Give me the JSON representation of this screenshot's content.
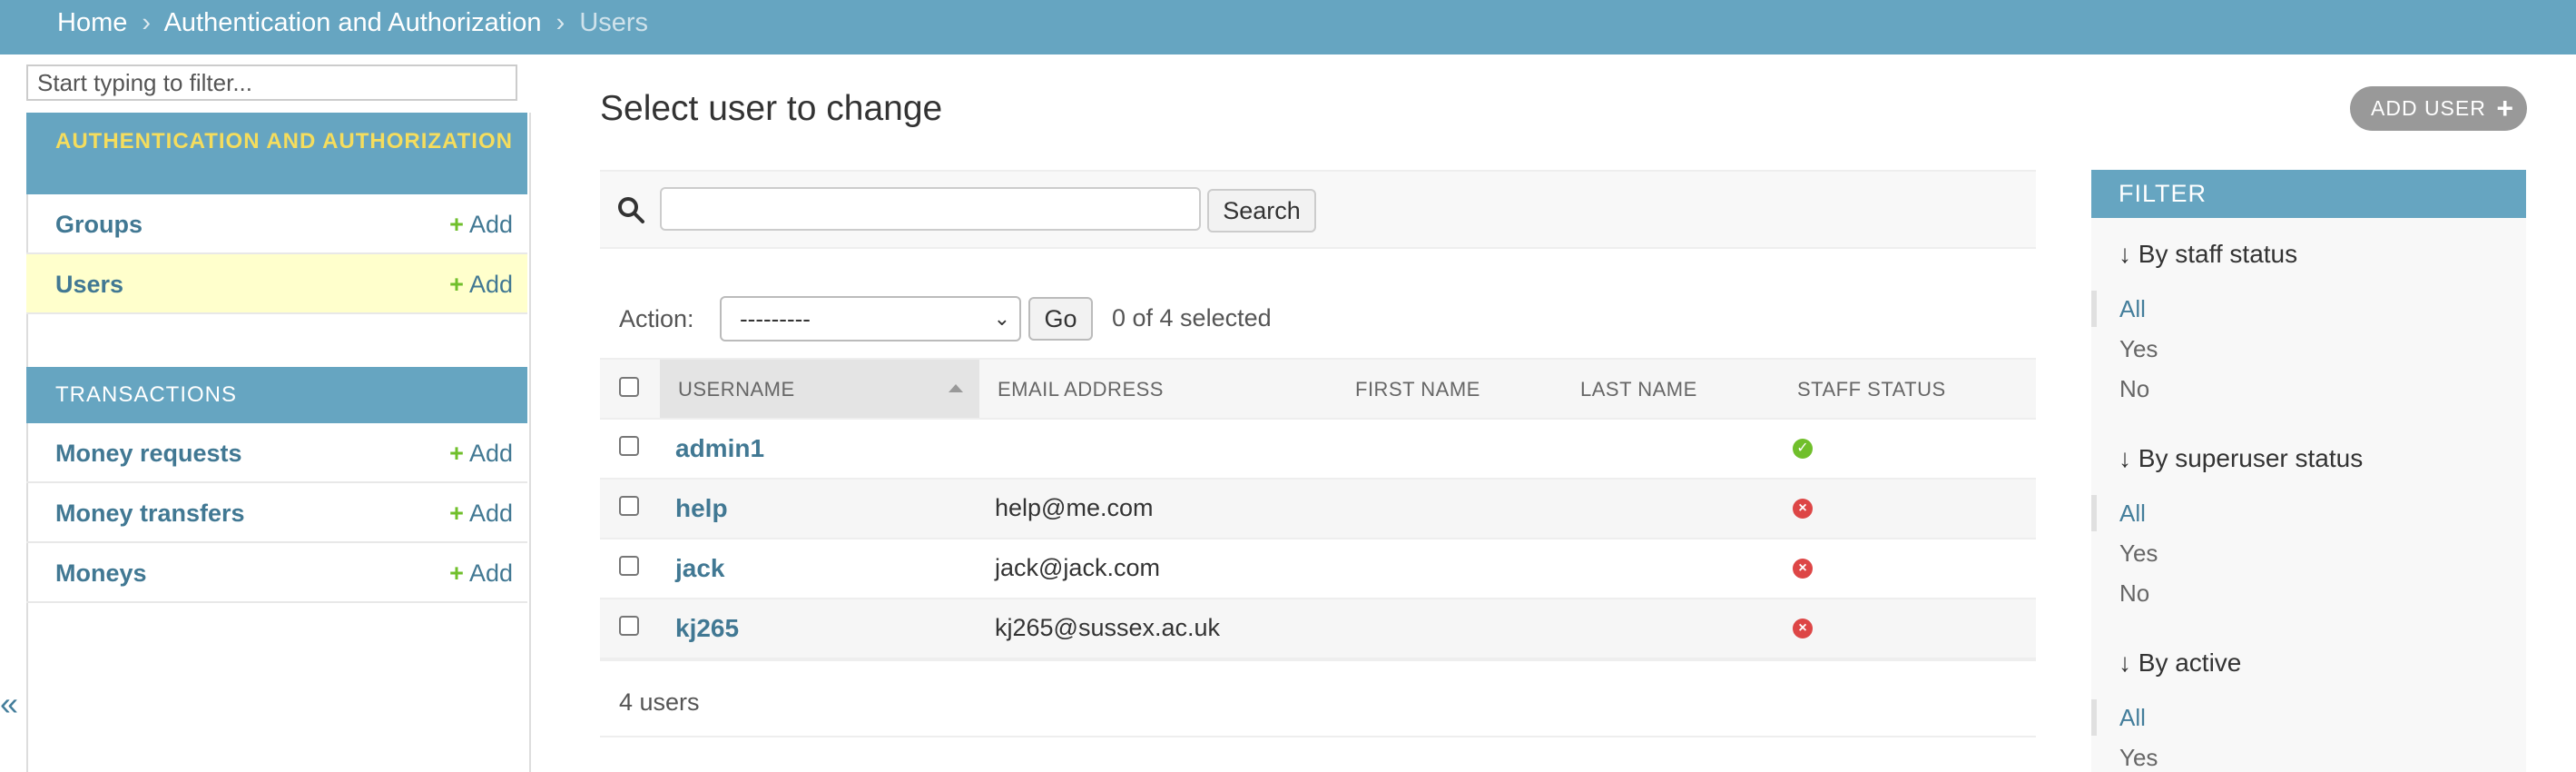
{
  "breadcrumbs": {
    "home": "Home",
    "sep": "›",
    "section": "Authentication and Authorization",
    "current": "Users"
  },
  "sidebar": {
    "filter_placeholder": "Start typing to filter...",
    "apps": [
      {
        "caption": "AUTHENTICATION AND AUTHORIZATION",
        "models": [
          {
            "name": "Groups",
            "add": "Add"
          },
          {
            "name": "Users",
            "add": "Add"
          }
        ]
      },
      {
        "caption": "TRANSACTIONS",
        "models": [
          {
            "name": "Money requests",
            "add": "Add"
          },
          {
            "name": "Money transfers",
            "add": "Add"
          },
          {
            "name": "Moneys",
            "add": "Add"
          }
        ]
      }
    ],
    "collapse_glyph": "«"
  },
  "main": {
    "title": "Select user to change",
    "add_button": "ADD USER",
    "search_button": "Search",
    "action_label": "Action:",
    "action_value": "---------",
    "go_button": "Go",
    "selected_count": "0 of 4 selected",
    "columns": [
      "USERNAME",
      "EMAIL ADDRESS",
      "FIRST NAME",
      "LAST NAME",
      "STAFF STATUS"
    ],
    "rows": [
      {
        "username": "admin1",
        "email": "",
        "staff": true
      },
      {
        "username": "help",
        "email": "help@me.com",
        "staff": false
      },
      {
        "username": "jack",
        "email": "jack@jack.com",
        "staff": false
      },
      {
        "username": "kj265",
        "email": "kj265@sussex.ac.uk",
        "staff": false
      }
    ],
    "paginator": "4 users"
  },
  "filter": {
    "title": "FILTER",
    "groups": [
      {
        "heading": "By staff status",
        "options": [
          "All",
          "Yes",
          "No"
        ]
      },
      {
        "heading": "By superuser status",
        "options": [
          "All",
          "Yes",
          "No"
        ]
      },
      {
        "heading": "By active",
        "options": [
          "All",
          "Yes"
        ]
      }
    ]
  },
  "colors": {
    "header": "#66a5c1",
    "link": "#417893",
    "highlight": "#ffffcc",
    "caption_accent": "#f5dd5d"
  }
}
